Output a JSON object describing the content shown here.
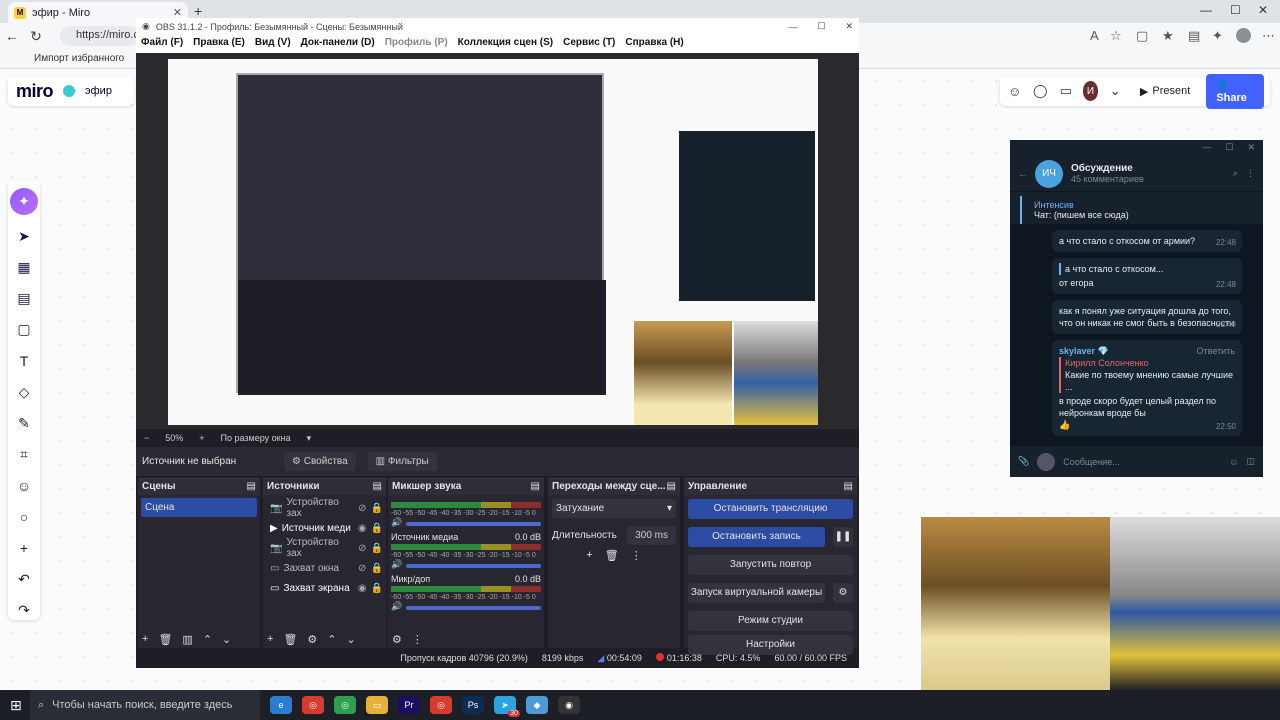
{
  "browser": {
    "tab_title": "эфир - Miro",
    "tab_close": "✕",
    "new_tab": "+",
    "url": "https://miro.co",
    "bookmark": "Импорт избранного",
    "win_min": "—",
    "win_max": "☐",
    "win_close": "✕"
  },
  "miro": {
    "logo": "miro",
    "board_name": "эфир",
    "present": "Present",
    "share": "Share",
    "user_initial": "И",
    "accent": "#4262ff"
  },
  "telegram": {
    "avatar": "ИЧ",
    "title": "Обсуждение",
    "subtitle": "45 комментариев",
    "pin_title": "Интенсив",
    "pin_text": "Чат: (пишем все сюда)",
    "messages": [
      {
        "text": "а что стало с откосом от армии?",
        "time": "22:48"
      },
      {
        "text": "а что стало с откосом...",
        "sub": "от егора",
        "time": "22:48"
      },
      {
        "text": "как я понял уже ситуация дошла до того, что он никак не смог быть в безопасности",
        "time": "22:48"
      }
    ],
    "reply_sender": "skylaver 💎",
    "reply_action": "Ответить",
    "reply_name": "Кирилл Солонченко",
    "reply_quote": "Какие по твоему мнению самые лучшие ...",
    "reply_text": "в проде скоро будет целый раздел по нейронкам вроде бы",
    "reply_reaction": "👍",
    "reply_time": "22:50",
    "input_placeholder": "Сообщение..."
  },
  "obs": {
    "title": "OBS 31.1.2 - Профиль: Безымянный - Сцены: Безымянный",
    "menu": [
      "Файл (F)",
      "Правка (E)",
      "Вид (V)",
      "Док-панели (D)",
      "Профиль (P)",
      "Коллекция сцен (S)",
      "Сервис (T)",
      "Справка (H)"
    ],
    "zoom": "50%",
    "zoom_mode": "По размеру окна",
    "no_source": "Источник не выбран",
    "props": "Свойства",
    "filters": "Фильтры",
    "scenes_title": "Сцены",
    "scene_item": "Сцена",
    "sources_title": "Источники",
    "sources": [
      "Устройство зах",
      "Источник меди",
      "Устройство зах",
      "Захват окна",
      "Захват экрана"
    ],
    "mixer_title": "Микшер звука",
    "mixer": [
      {
        "name": "",
        "db": ""
      },
      {
        "name": "Источник медиа",
        "db": "0.0 dB"
      },
      {
        "name": "Микр/доп",
        "db": "0.0 dB"
      }
    ],
    "meter_scale": "-60 -55 -50 -45 -40 -35 -30 -25 -20 -15 -10 -5 0",
    "transitions_title": "Переходы между сце...",
    "transition": "Затухание",
    "duration_label": "Длительность",
    "duration": "300 ms",
    "controls_title": "Управление",
    "controls": [
      "Остановить трансляцию",
      "Остановить запись",
      "Запустить повтор",
      "Запуск виртуальной камеры",
      "Режим студии",
      "Настройки"
    ],
    "status": {
      "dropped": "Пропуск кадров 40796 (20.9%)",
      "bitrate": "8199 kbps",
      "stream_time": "00:54:09",
      "rec_time": "01:16:38",
      "cpu": "CPU: 4.5%",
      "fps": "60.00 / 60.00 FPS"
    }
  },
  "taskbar": {
    "search": "Чтобы начать поиск, введите здесь",
    "badge": "30"
  }
}
